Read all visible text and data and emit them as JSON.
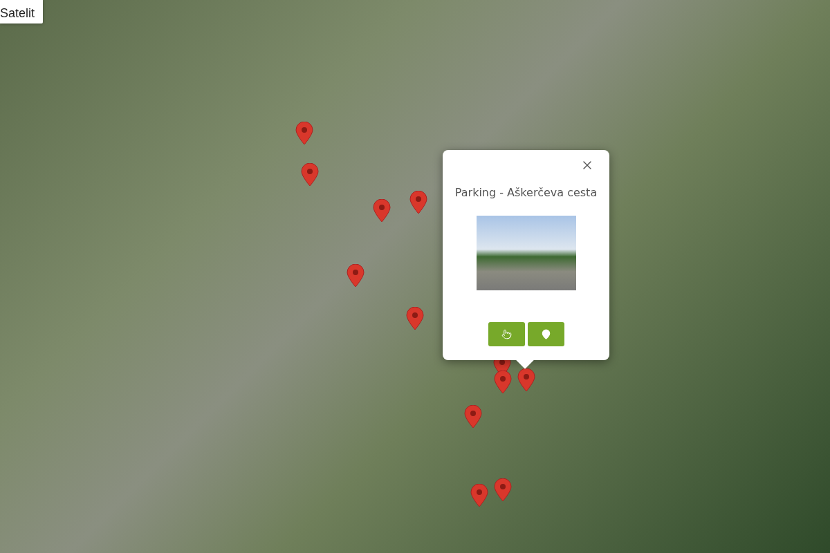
{
  "map_type_button": {
    "label": "Satelit"
  },
  "popup": {
    "title": "Parking - Aškerčeva cesta",
    "actions": [
      {
        "kind": "select"
      },
      {
        "kind": "locate"
      }
    ]
  }
}
